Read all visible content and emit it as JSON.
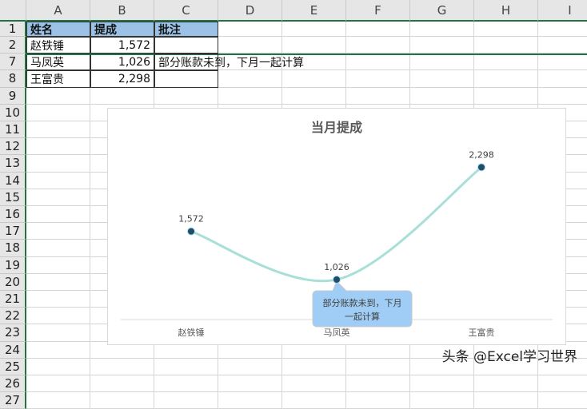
{
  "columns": [
    "A",
    "B",
    "C",
    "D",
    "E",
    "F",
    "G",
    "H",
    "I"
  ],
  "rows": [
    "1",
    "2",
    "7",
    "8",
    "9",
    "10",
    "11",
    "12",
    "13",
    "14",
    "15",
    "16",
    "17",
    "18",
    "19",
    "20",
    "21",
    "22",
    "23",
    "24",
    "25",
    "26",
    "27"
  ],
  "table": {
    "headers": [
      "姓名",
      "提成",
      "批注"
    ],
    "data": [
      {
        "row": "2",
        "name": "赵铁锤",
        "value": "1,572",
        "note": ""
      },
      {
        "row": "7",
        "name": "马凤英",
        "value": "1,026",
        "note": "部分账款未到，下月一起计算"
      },
      {
        "row": "8",
        "name": "王富贵",
        "value": "2,298",
        "note": ""
      }
    ]
  },
  "chart_data": {
    "type": "line",
    "title": "当月提成",
    "categories": [
      "赵铁锤",
      "马凤英",
      "王富贵"
    ],
    "values": [
      1572,
      1026,
      2298
    ],
    "value_labels": [
      "1,572",
      "1,026",
      "2,298"
    ],
    "ylim": [
      700,
      2600
    ],
    "smooth": true,
    "line_color": "#a8e0d8",
    "marker_color": "#1f4e6b",
    "grid": false,
    "callout": {
      "category": "马凤英",
      "text": "部分账款未到，下月一起计算",
      "line1": "部分账款未到，下月",
      "line2": "一起计算",
      "color": "#9fcdf5"
    }
  },
  "watermark": "头条 @Excel学习世界"
}
